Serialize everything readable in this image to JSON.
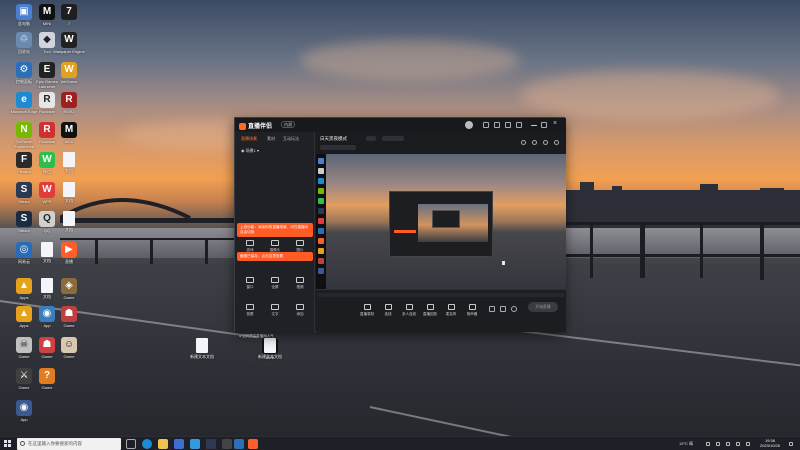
{
  "desktop": {
    "icons": [
      {
        "id": "icon-1",
        "label": "此电脑",
        "glyph": "▣",
        "color": "#4a7fd0"
      },
      {
        "id": "icon-2",
        "label": "MINI",
        "glyph": "M",
        "color": "#111111"
      },
      {
        "id": "icon-3",
        "label": "7",
        "glyph": "7",
        "color": "#1e1e1e"
      },
      {
        "id": "icon-4",
        "label": "回收站",
        "glyph": "♲",
        "color": "#6b8ab0"
      },
      {
        "id": "icon-5",
        "label": "Tool",
        "glyph": "◆",
        "color": "#d0d4df"
      },
      {
        "id": "icon-6",
        "label": "Wallpaper Engine",
        "glyph": "W",
        "color": "#222222"
      },
      {
        "id": "icon-7",
        "label": "控制面板",
        "glyph": "⚙",
        "color": "#2a6fb8"
      },
      {
        "id": "icon-8",
        "label": "Epic Games Launcher",
        "glyph": "E",
        "color": "#222222"
      },
      {
        "id": "icon-9",
        "label": "WeGame",
        "glyph": "W",
        "color": "#e0a020"
      },
      {
        "id": "icon-10",
        "label": "Microsoft Edge",
        "glyph": "e",
        "color": "#1b8bd6"
      },
      {
        "id": "icon-11",
        "label": "Rockstar",
        "glyph": "R",
        "color": "#e6e6e6"
      },
      {
        "id": "icon-12",
        "label": "RDR2",
        "glyph": "R",
        "color": "#a02020"
      },
      {
        "id": "icon-13",
        "label": "GeForce Experience",
        "glyph": "N",
        "color": "#76b900"
      },
      {
        "id": "icon-14",
        "label": "Rockstar",
        "glyph": "R",
        "color": "#d03030"
      },
      {
        "id": "icon-15",
        "label": "MINI",
        "glyph": "M",
        "color": "#111111"
      },
      {
        "id": "icon-16",
        "label": "Filmora",
        "glyph": "F",
        "color": "#2a2a2a"
      },
      {
        "id": "icon-17",
        "label": "微信",
        "glyph": "W",
        "color": "#2dbf4c"
      },
      {
        "id": "icon-18",
        "label": "文档",
        "glyph": "",
        "color": "#f4f5f8"
      },
      {
        "id": "icon-19",
        "label": "Steam",
        "glyph": "S",
        "color": "#2a3a52"
      },
      {
        "id": "icon-20",
        "label": "WPS",
        "glyph": "W",
        "color": "#e23b3b"
      },
      {
        "id": "icon-21",
        "label": "文档",
        "glyph": "",
        "color": "#f4f5f8"
      },
      {
        "id": "icon-22",
        "label": "Steam",
        "glyph": "S",
        "color": "#1b2b44"
      },
      {
        "id": "icon-23",
        "label": "QQ",
        "glyph": "Q",
        "color": "#d0d0d0"
      },
      {
        "id": "icon-24",
        "label": "文档",
        "glyph": "",
        "color": "#f4f5f8"
      },
      {
        "id": "icon-25",
        "label": "网易云",
        "glyph": "◎",
        "color": "#2b6cb8"
      },
      {
        "id": "icon-26",
        "label": "文档",
        "glyph": "",
        "color": "#f4f5f8"
      },
      {
        "id": "icon-27",
        "label": "直播",
        "glyph": "▶",
        "color": "#ff5d2a"
      },
      {
        "id": "icon-28",
        "label": "Apps",
        "glyph": "▲",
        "color": "#e6a21c"
      },
      {
        "id": "icon-29",
        "label": "文档",
        "glyph": "",
        "color": "#f4f5f8"
      },
      {
        "id": "icon-30",
        "label": "Game",
        "glyph": "◈",
        "color": "#8a6c3c"
      },
      {
        "id": "icon-31",
        "label": "Apps",
        "glyph": "▲",
        "color": "#e6a21c"
      },
      {
        "id": "icon-32",
        "label": "App",
        "glyph": "◉",
        "color": "#3a7ec0"
      },
      {
        "id": "icon-33",
        "label": "Game",
        "glyph": "☗",
        "color": "#c04040"
      },
      {
        "id": "icon-34",
        "label": "Game",
        "glyph": "☠",
        "color": "#c0c0c0"
      },
      {
        "id": "icon-35",
        "label": "Game",
        "glyph": "☗",
        "color": "#d04040"
      },
      {
        "id": "icon-36",
        "label": "Game",
        "glyph": "☺",
        "color": "#d8c8b0"
      },
      {
        "id": "icon-37",
        "label": "Game",
        "glyph": "⚔",
        "color": "#404040"
      },
      {
        "id": "icon-38",
        "label": "Game",
        "glyph": "?",
        "color": "#e07d20"
      },
      {
        "id": "icon-39",
        "label": "App",
        "glyph": "◉",
        "color": "#3a5a90"
      },
      {
        "id": "icon-40",
        "label": "MINI",
        "glyph": "M",
        "color": "#111111"
      },
      {
        "id": "icon-41",
        "label": "新建文本文档",
        "glyph": "",
        "color": "#f4f5f8"
      },
      {
        "id": "icon-42",
        "label": "新建文本文档",
        "glyph": "",
        "color": "#f4f5f8"
      }
    ]
  },
  "app": {
    "name": "直播伴侣",
    "badge": "内测",
    "left_tabs": [
      "直播场景",
      "素材",
      "互动玩法"
    ],
    "scene_label": "场景1",
    "tools": [
      {
        "label": "游戏",
        "icon": "gamepad-icon"
      },
      {
        "label": "摄像头",
        "icon": "camera-icon"
      },
      {
        "label": "图片",
        "icon": "image-icon"
      },
      {
        "label": "窗口",
        "icon": "window-icon"
      },
      {
        "label": "全屏",
        "icon": "fullscreen-icon"
      },
      {
        "label": "视频",
        "icon": "video-icon"
      },
      {
        "label": "投屏",
        "icon": "cast-icon"
      },
      {
        "label": "文字",
        "icon": "text-icon"
      },
      {
        "label": "添加",
        "icon": "plus-icon"
      }
    ],
    "tip_1": "上线功能：添加你的直播场景，可在直播中自由切换",
    "tip_2": "截图已保存，点击这里查看",
    "bottom_note": "如何提高直播间人气",
    "stage_title": "白天黑夜模式",
    "bottom_buttons": [
      {
        "label": "直播录制",
        "icon": "record-icon"
      },
      {
        "label": "连线",
        "icon": "link-icon"
      },
      {
        "label": "多人连线",
        "icon": "multi-link-icon"
      },
      {
        "label": "直播回放",
        "icon": "replay-icon"
      },
      {
        "label": "麦克风",
        "icon": "mic-icon"
      },
      {
        "label": "扬声器",
        "icon": "speaker-icon"
      }
    ],
    "start_live": "开始直播"
  },
  "taskbar": {
    "search_placeholder": "在这里输入你要搜索的内容",
    "temperature": "19°C 晴",
    "time": "19:36",
    "date": "2023/10/26"
  }
}
